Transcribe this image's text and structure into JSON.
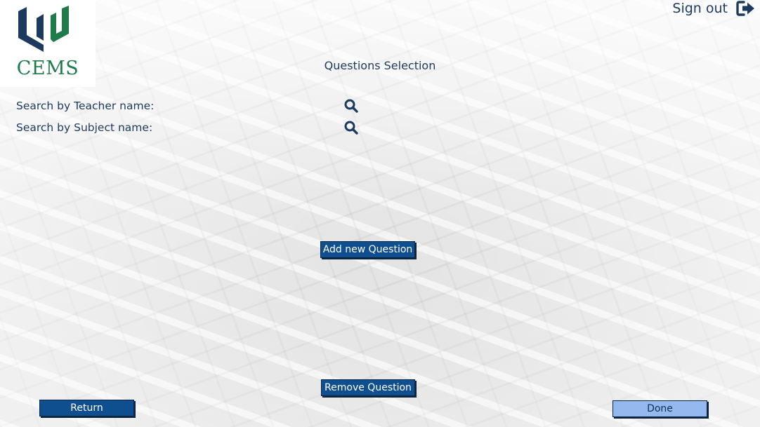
{
  "logo": {
    "text": "CEMS"
  },
  "header": {
    "sign_out_label": "Sign out"
  },
  "page": {
    "title": "Questions Selection"
  },
  "search": {
    "teacher_label": "Search by Teacher name:",
    "subject_label": "Search by Subject name:"
  },
  "actions": {
    "add_question": "Add new Question",
    "remove_question": "Remove Question",
    "return": "Return",
    "done": "Done"
  },
  "colors": {
    "primary": "#0f4f8f",
    "primary_light": "#94b9ef",
    "text_dark": "#1c3a5e",
    "logo_green": "#1f7b4a",
    "logo_navy": "#1c3a5e"
  },
  "icons": {
    "logo": "cems-logo-icon",
    "sign_out": "sign-out-icon",
    "search": "search-icon"
  }
}
